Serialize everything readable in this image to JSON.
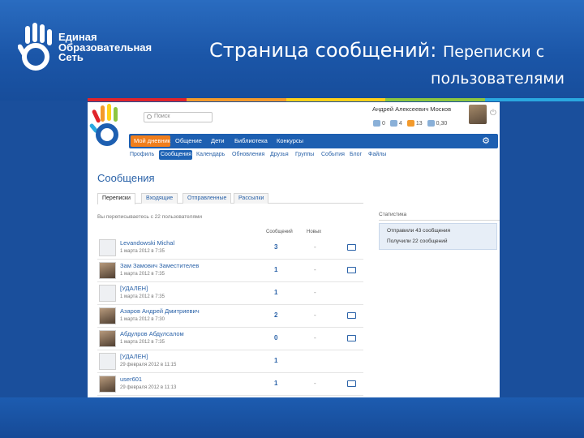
{
  "slide": {
    "logo_lines": [
      "Единая",
      "Образовательная",
      "Сеть"
    ],
    "title_main": "Страница сообщений: ",
    "title_sub": "Переписки с",
    "title_line2": "пользователями",
    "stripe_colors": [
      "#e0242b",
      "#f39a2b",
      "#ffd11a",
      "#8dc63f",
      "#2aa8e0"
    ]
  },
  "header": {
    "search_placeholder": "Поиск",
    "username": "Андрей Алексеевич Москов",
    "counters": [
      {
        "icon": "messages-icon",
        "value": "0"
      },
      {
        "icon": "contacts-icon",
        "value": "4"
      },
      {
        "icon": "notifications-icon",
        "value": "13"
      },
      {
        "icon": "rating-icon",
        "value": "0,30"
      }
    ]
  },
  "nav": {
    "items": [
      "Мой дневник",
      "Общение",
      "Дети",
      "Библиотека",
      "Конкурсы"
    ]
  },
  "subnav": {
    "items": [
      "Профиль",
      "Сообщения",
      "Календарь",
      "Обновления",
      "Друзья",
      "Группы",
      "События",
      "Блог",
      "Файлы"
    ]
  },
  "page": {
    "title": "Сообщения",
    "tabs": [
      "Переписки",
      "Входящие",
      "Отправленные",
      "Рассылки"
    ],
    "summary": "Вы переписываетесь с 22 пользователями",
    "col_messages": "Сообщений",
    "col_new": "Новых"
  },
  "rows": [
    {
      "name": "Levandowski Michal",
      "date": "1 марта 2012 в 7:35",
      "count": "3",
      "new": "-",
      "mail": true,
      "photo": false
    },
    {
      "name": "Зам Замович Заместителев",
      "date": "1 марта 2012 в 7:35",
      "count": "1",
      "new": "-",
      "mail": true,
      "photo": true
    },
    {
      "name": "[УДАЛЕН]",
      "date": "1 марта 2012 в 7:35",
      "count": "1",
      "new": "-",
      "mail": false,
      "photo": false
    },
    {
      "name": "Азаров Андрей Дмитриевич",
      "date": "1 марта 2012 в 7:30",
      "count": "2",
      "new": "-",
      "mail": true,
      "photo": true
    },
    {
      "name": "Абдулров Абдулсалом",
      "date": "1 марта 2012 в 7:35",
      "count": "0",
      "new": "-",
      "mail": true,
      "photo": true
    },
    {
      "name": "[УДАЛЕН]",
      "date": "29 февраля 2012 в 11:15",
      "count": "1",
      "new": "",
      "mail": false,
      "photo": false
    },
    {
      "name": "user601",
      "date": "29 февраля 2012 в 11:13",
      "count": "1",
      "new": "-",
      "mail": true,
      "photo": true
    }
  ],
  "stats": {
    "heading": "Статистика",
    "sent": "Отправили 43 сообщения",
    "received": "Получили 22 сообщений"
  }
}
